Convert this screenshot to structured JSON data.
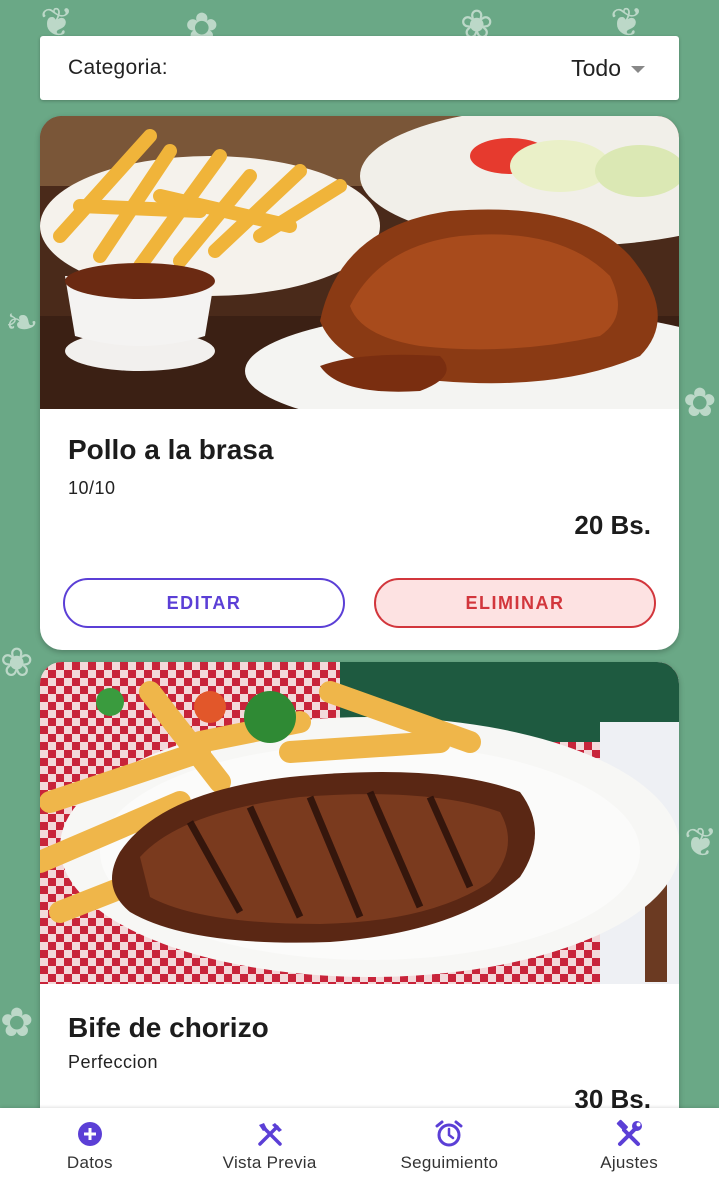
{
  "category": {
    "label": "Categoria:",
    "selected": "Todo"
  },
  "items": [
    {
      "title": "Pollo a la brasa",
      "subtitle": "10/10",
      "price": "20 Bs.",
      "edit_label": "EDITAR",
      "delete_label": "ELIMINAR",
      "image": "roast-chicken-with-fries-photo"
    },
    {
      "title": "Bife de chorizo",
      "subtitle": "Perfeccion",
      "price": "30 Bs.",
      "image": "grilled-steak-with-fries-photo"
    }
  ],
  "bottom_nav": [
    {
      "label": "Datos",
      "icon": "plus-circle-icon"
    },
    {
      "label": "Vista Previa",
      "icon": "fork-knife-icon"
    },
    {
      "label": "Seguimiento",
      "icon": "alarm-clock-icon"
    },
    {
      "label": "Ajustes",
      "icon": "tools-icon"
    }
  ],
  "colors": {
    "background": "#6aa886",
    "accent": "#5b3fd6",
    "danger": "#d2363c",
    "danger_bg": "#fde2e2"
  }
}
